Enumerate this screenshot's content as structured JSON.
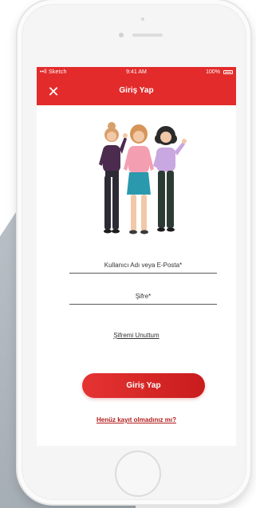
{
  "status_bar": {
    "carrier": "••ll Sketch",
    "wifi_icon": "wifi-icon",
    "time": "9:41 AM",
    "battery": "100%"
  },
  "nav": {
    "close_icon": "close-icon",
    "title": "Giriş Yap"
  },
  "illustration": {
    "description_icon": "three-women-illustration"
  },
  "form": {
    "username_label": "Kullanıcı Adı veya E-Posta*",
    "password_label": "Şifre*",
    "forgot_label": "Şifremi Unuttum",
    "login_label": "Giriş Yap",
    "register_label": "Henüz kayıt olmadınız mı?"
  },
  "colors": {
    "brand_red": "#e32b2b",
    "link_red": "#b31d1d"
  }
}
